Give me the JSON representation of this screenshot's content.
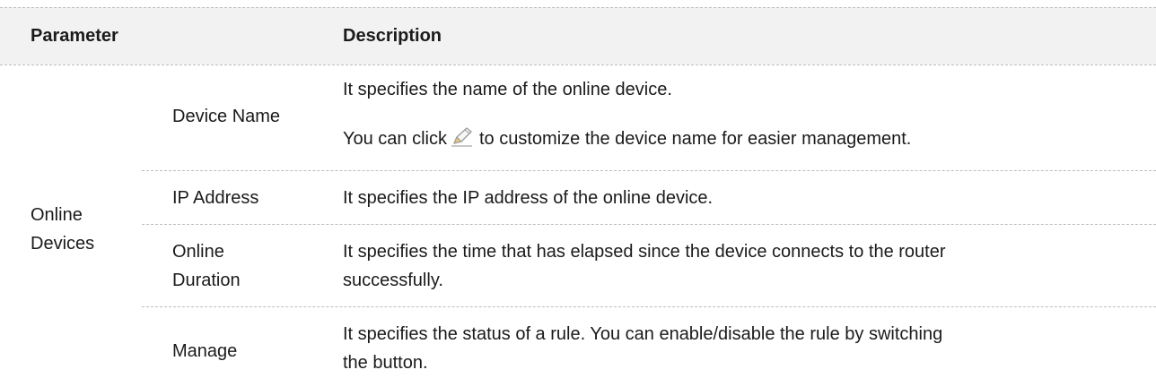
{
  "table": {
    "header": {
      "parameter": "Parameter",
      "description": "Description"
    },
    "group_label_line1": "Online",
    "group_label_line2": "Devices",
    "rows": [
      {
        "name": "Device Name",
        "desc_line1": "It specifies the name of the online device.",
        "desc_line2_before": "You can click",
        "desc_line2_after": "to customize the device name for easier management."
      },
      {
        "name": "IP Address",
        "desc": "It specifies the IP address of the online device."
      },
      {
        "name_line1": "Online",
        "name_line2": "Duration",
        "desc_line1": "It specifies the time that has elapsed since the device connects to the router",
        "desc_line2": "successfully."
      },
      {
        "name": "Manage",
        "desc_line1": "It specifies the status of a rule. You can enable/disable the rule by switching",
        "desc_line2": "the button."
      }
    ]
  },
  "icons": {
    "edit": "pencil-icon"
  }
}
